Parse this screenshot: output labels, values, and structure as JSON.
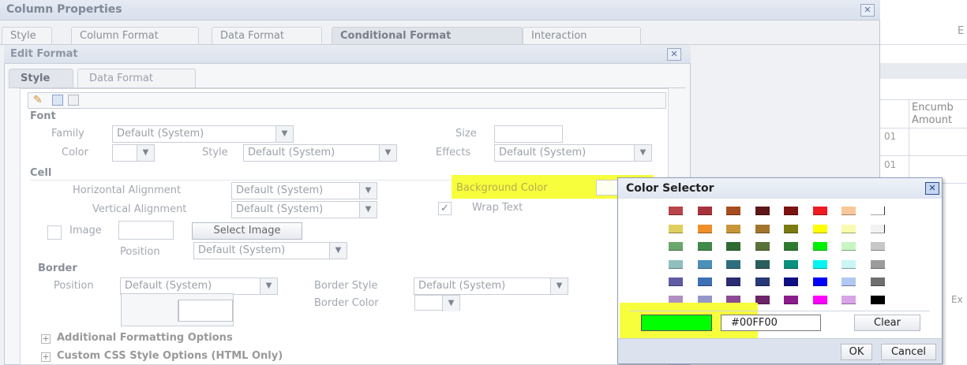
{
  "outer": {
    "title": "Column Properties",
    "tabs": [
      "Style",
      "Column Format",
      "Data Format",
      "Conditional Format",
      "Interaction"
    ],
    "active_tab": "Conditional Format"
  },
  "background": {
    "col_header_line1": "Encumb",
    "col_header_line2": "Amount",
    "cell1": "01",
    "cell2": "01",
    "top_right": "E",
    "bottom_right": "Ex"
  },
  "edit": {
    "title": "Edit Format",
    "tabs": [
      "Style",
      "Data Format"
    ],
    "active_tab": "Style",
    "font": {
      "section": "Font",
      "family_label": "Family",
      "family_value": "Default (System)",
      "size_label": "Size",
      "size_value": "",
      "color_label": "Color",
      "style_label": "Style",
      "style_value": "Default (System)",
      "effects_label": "Effects",
      "effects_value": "Default (System)"
    },
    "cell": {
      "section": "Cell",
      "halign_label": "Horizontal Alignment",
      "halign_value": "Default (System)",
      "bg_color_label": "Background Color",
      "valign_label": "Vertical Alignment",
      "valign_value": "Default (System)",
      "wrap_text_label": "Wrap Text",
      "wrap_text_checked": true,
      "image_label": "Image",
      "select_image_button": "Select Image",
      "position_label": "Position",
      "position_value": "Default (System)"
    },
    "border": {
      "section": "Border",
      "position_label": "Position",
      "position_value": "Default (System)",
      "border_style_label": "Border Style",
      "border_style_value": "Default (System)",
      "border_color_label": "Border Color"
    },
    "additional": "Additional Formatting Options",
    "custom_css": "Custom CSS Style Options (HTML Only)"
  },
  "color_selector": {
    "title": "Color Selector",
    "swatches": [
      [
        "#b9444a",
        "#a8323c",
        "#a84d1f",
        "#5e1616",
        "#7d1212",
        "#ee1b23",
        "#f8c89a",
        "#ffffff"
      ],
      [
        "#dfcf5e",
        "#ef8e2a",
        "#c89638",
        "#a3752c",
        "#7a7b10",
        "#ffff00",
        "#f9fbb0",
        "#f2f2f2"
      ],
      [
        "#6aa76c",
        "#3f8a4a",
        "#2e6b32",
        "#59723a",
        "#2e7a30",
        "#00f000",
        "#c7f6c3",
        "#c8c8c8"
      ],
      [
        "#8fc0bf",
        "#4c8fb8",
        "#2d6f7e",
        "#2a5d5c",
        "#0b8f7f",
        "#00f5f0",
        "#c9f5f4",
        "#9c9c9c"
      ],
      [
        "#5f5ca4",
        "#3e70b6",
        "#2c2c72",
        "#273a77",
        "#0e0f83",
        "#0000ff",
        "#b0c8f2",
        "#6e6e6e"
      ],
      [
        "#b090c0",
        "#9497c8",
        "#8c4a92",
        "#6b2468",
        "#8c1c8c",
        "#ff00ff",
        "#d7a4e8",
        "#000000"
      ]
    ],
    "selected_color": "#00FF00",
    "hex_value": "#00FF00",
    "clear_button": "Clear",
    "ok_button": "OK",
    "cancel_button": "Cancel"
  }
}
